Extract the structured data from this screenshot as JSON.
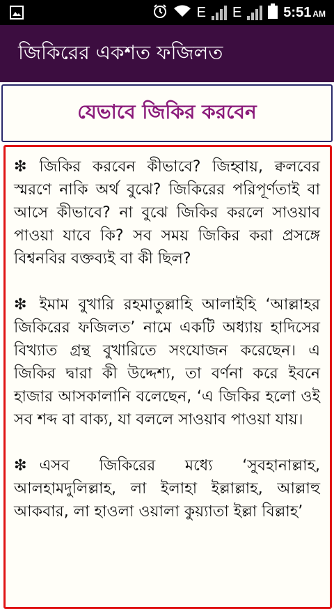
{
  "status_bar": {
    "network_1": "E",
    "network_2": "E",
    "time": "5:51",
    "ampm": "AM"
  },
  "app_bar": {
    "title": "জিকিরের একশত ফজিলত"
  },
  "section": {
    "title": "যেভাবে জিকির করবেন"
  },
  "content": {
    "bullet": "❇",
    "paragraphs": [
      "জিকির করবেন কীভাবে? জিহ্বায়, ক্বলবের স্মরণে নাকি অর্থ বুঝে? জিকিরের পরিপূর্ণতাই বা আসে কীভাবে? না বুঝে জিকির করলে সাওয়াব পাওয়া যাবে কি? সব সময় জিকির করা প্রসঙ্গে বিশ্বনবির বক্তব্যই বা কী ছিল?",
      "ইমাম বুখারি রহমাতুল্লাহি আলাইহি ‘আল্লাহর জিকিরের ফজিলত’ নামে একটি অধ্যায় হাদিসের বিখ্যাত গ্রন্থ বুখারিতে সংযোজন করেছেন। এ জিকির দ্বারা কী উদ্দেশ্য, তা বর্ণনা করে ইবনে হাজার আসকালানি বলেছেন, ‘এ জিকির হলো ওই সব শব্দ বা বাক্য, যা বললে সাওয়াব পাওয়া যায়।",
      "এসব জিকিরের মধ্যে ‘সুবহানাল্লাহ, আলহামদুলিল্লাহ, লা ইলাহা ইল্লাল্লাহ, আল্লাহু আকবার, লা হাওলা ওয়ালা কুয়্যাতা ইল্লা বিল্লাহ’"
    ]
  }
}
